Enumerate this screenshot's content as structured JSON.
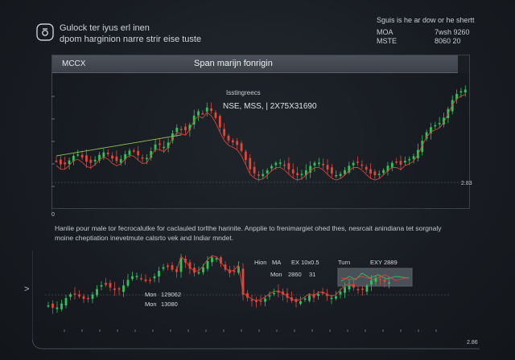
{
  "header": {
    "line1": "Gulock ter iyus erl inen",
    "line2": "dpom harginion narre strir eise tuste"
  },
  "top_right": {
    "title": "Sguis is he ar dow or he shertt",
    "rows": [
      {
        "key": "MOA",
        "value": "7wsh 9260"
      },
      {
        "key": "MSTE",
        "value": "8060 20"
      }
    ]
  },
  "panel1": {
    "code": "MCCX",
    "title": "Span marijn fonrigin",
    "note": "Isstingreecs",
    "subtitle": "NSE, MSS, | 2X75X31690",
    "right_label": "2.83",
    "axis_label": "0"
  },
  "paragraph": {
    "line1": "Hanlie pour male tor fecrocalutke for caclauled torlthe harinite. Anpplie to frenimargiet ohed thes, nesrcait anindiana tet sorgnaly",
    "line2": "moine cheptiation inevetmute calsrto vek and Indiar mndet."
  },
  "chart2_labels": {
    "hion": "Hion",
    "ma": "MA",
    "ex": "EX 10x0.5",
    "mon_a": "Mon",
    "val_a": "2860",
    "val_b": "31",
    "turn": "Turn",
    "exy": "EXY 2889",
    "mon1": "Mon",
    "mon1_val": "129062",
    "mon2": "Mon",
    "mon2_val": "13080",
    "corner": "2.86"
  },
  "colors": {
    "up": "#2fc25b",
    "down": "#e0463a",
    "ma_red": "#d8453b",
    "ma_green": "#8fbf52"
  },
  "icons": {
    "logo": "wallet-icon",
    "arrow": "arrow-right-icon"
  }
}
